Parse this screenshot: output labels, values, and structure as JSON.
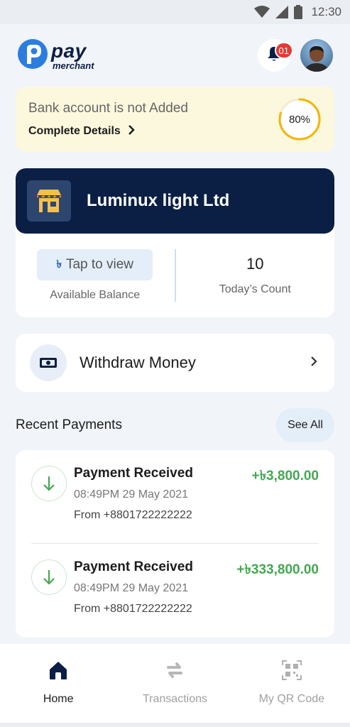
{
  "status_bar": {
    "time": "12:30"
  },
  "header": {
    "logo_primary": "pay",
    "logo_secondary": "merchant",
    "notification_count": "01"
  },
  "bank_alert": {
    "title": "Bank account is not Added",
    "action_label": "Complete Details",
    "progress_label": "80%",
    "progress_value": 0.8
  },
  "merchant": {
    "name": "Luminux light Ltd",
    "balance_symbol": "৳",
    "balance_button": "Tap to view",
    "balance_label": "Available Balance",
    "count_value": "10",
    "count_label": "Today’s Count"
  },
  "withdraw": {
    "label": "Withdraw Money"
  },
  "recent": {
    "title": "Recent Payments",
    "see_all": "See All",
    "items": [
      {
        "title": "Payment Received",
        "time": "08:49PM 29 May 2021",
        "from": "From +8801722222222",
        "amount": "+৳3,800.00"
      },
      {
        "title": "Payment Received",
        "time": "08:49PM 29 May 2021",
        "from": "From +8801722222222",
        "amount": "+৳333,800.00"
      }
    ]
  },
  "nav": {
    "items": [
      {
        "label": "Home",
        "icon": "home-icon",
        "active": true
      },
      {
        "label": "Transactions",
        "icon": "transfer-icon",
        "active": false
      },
      {
        "label": "My QR Code",
        "icon": "qr-code-icon",
        "active": false
      }
    ]
  },
  "colors": {
    "brand_navy": "#0b1f44",
    "positive_green": "#43a851",
    "alert_bg": "#fcf8dd",
    "progress_ring": "#f5b400",
    "badge_red": "#e53935"
  }
}
